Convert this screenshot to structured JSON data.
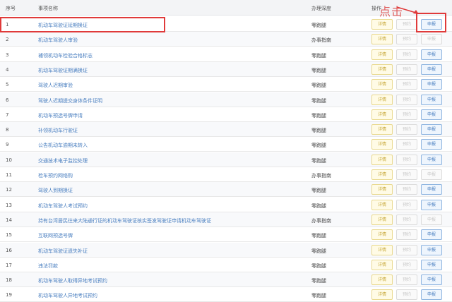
{
  "table": {
    "headers": {
      "no": "序号",
      "name": "事项名称",
      "depth": "办理深度",
      "ops": "操作"
    },
    "rows": [
      {
        "no": "1",
        "name": "机动车驾驶证延期换证",
        "depth": "零跑腿",
        "detail": "详情",
        "preview": "预约",
        "apply": "申报",
        "apply_enabled": true
      },
      {
        "no": "2",
        "name": "机动车驾驶人审验",
        "depth": "办事指南",
        "detail": "详情",
        "preview": "预约",
        "apply": "申报",
        "apply_enabled": false
      },
      {
        "no": "3",
        "name": "補领机动车检验合格标志",
        "depth": "零跑腿",
        "detail": "详情",
        "preview": "预约",
        "apply": "申报",
        "apply_enabled": true
      },
      {
        "no": "4",
        "name": "机动车驾驶证期满换证",
        "depth": "零跑腿",
        "detail": "详情",
        "preview": "预约",
        "apply": "申报",
        "apply_enabled": true
      },
      {
        "no": "5",
        "name": "驾驶人迟期审验",
        "depth": "零跑腿",
        "detail": "详情",
        "preview": "预约",
        "apply": "申报",
        "apply_enabled": true
      },
      {
        "no": "6",
        "name": "驾驶人迟期提交身体条件证明",
        "depth": "零跑腿",
        "detail": "详情",
        "preview": "预约",
        "apply": "申报",
        "apply_enabled": true
      },
      {
        "no": "7",
        "name": "机动车预选号牌申请",
        "depth": "零跑腿",
        "detail": "详情",
        "preview": "预约",
        "apply": "申报",
        "apply_enabled": true
      },
      {
        "no": "8",
        "name": "补领机动车行驶证",
        "depth": "零跑腿",
        "detail": "详情",
        "preview": "预约",
        "apply": "申报",
        "apply_enabled": true
      },
      {
        "no": "9",
        "name": "公告机动车逾期未转入",
        "depth": "零跑腿",
        "detail": "详情",
        "preview": "预约",
        "apply": "申报",
        "apply_enabled": true
      },
      {
        "no": "10",
        "name": "交通技术电子监控处理",
        "depth": "零跑腿",
        "detail": "详情",
        "preview": "预约",
        "apply": "申报",
        "apply_enabled": true
      },
      {
        "no": "11",
        "name": "检车预约网络购",
        "depth": "办事指南",
        "detail": "详情",
        "preview": "预约",
        "apply": "申报",
        "apply_enabled": false
      },
      {
        "no": "12",
        "name": "驾驶人到期换证",
        "depth": "零跑腿",
        "detail": "详情",
        "preview": "预约",
        "apply": "申报",
        "apply_enabled": true
      },
      {
        "no": "13",
        "name": "机动车驾驶人考试预约",
        "depth": "零跑腿",
        "detail": "详情",
        "preview": "预约",
        "apply": "申报",
        "apply_enabled": true
      },
      {
        "no": "14",
        "name": "持有台湾居民往来大陆通行证的机动车驾驶证核实签发驾驶证申请机动车驾驶证",
        "depth": "办事指南",
        "detail": "详情",
        "preview": "预约",
        "apply": "申报",
        "apply_enabled": false
      },
      {
        "no": "15",
        "name": "互联网预选号牌",
        "depth": "零跑腿",
        "detail": "详情",
        "preview": "预约",
        "apply": "申报",
        "apply_enabled": true
      },
      {
        "no": "16",
        "name": "机动车驾驶证遗失补证",
        "depth": "零跑腿",
        "detail": "详情",
        "preview": "预约",
        "apply": "申报",
        "apply_enabled": true
      },
      {
        "no": "17",
        "name": "违法罚款",
        "depth": "零跑腿",
        "detail": "详情",
        "preview": "预约",
        "apply": "申报",
        "apply_enabled": true
      },
      {
        "no": "18",
        "name": "机动车驾驶人取得异地考试预约",
        "depth": "零跑腿",
        "detail": "详情",
        "preview": "预约",
        "apply": "申报",
        "apply_enabled": true
      },
      {
        "no": "19",
        "name": "机动车驾驶人异地考试预约",
        "depth": "零跑腿",
        "detail": "详情",
        "preview": "预约",
        "apply": "申报",
        "apply_enabled": true
      }
    ]
  },
  "annotation": {
    "click_label": "点击"
  },
  "colors": {
    "highlight": "#e03a3a",
    "link": "#4a7fc0",
    "detail": "#c8a93a"
  }
}
